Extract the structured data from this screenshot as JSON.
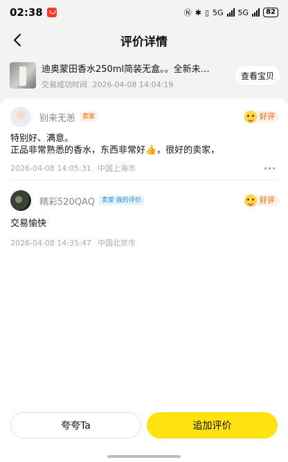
{
  "status_bar": {
    "time": "02:38",
    "net_1": "5G",
    "net_2": "5G",
    "battery": "82",
    "icons": [
      "nfc-icon",
      "bluetooth-icon",
      "vibrate-icon",
      "signal-icon",
      "battery-icon"
    ]
  },
  "nav": {
    "title": "评价详情",
    "back_icon": "back-arrow-icon"
  },
  "product": {
    "title": "迪奥蒙田香水250ml简装无盒。。全新未…",
    "meta_label": "交易成功时间",
    "meta_time": "2026-04-08 14:04:19",
    "view_button": "查看宝贝"
  },
  "reviews": [
    {
      "username": "别来无恙",
      "tag": "卖家",
      "rating": "好评",
      "text": "特别好、满意。\n正品非常熟悉的香水，东西非常好👍，很好的卖家，",
      "time": "2026-04-08 14:05:31",
      "location": "中国上海市"
    },
    {
      "username": "精彩520QAQ",
      "tag": "卖家·我的评价",
      "rating": "好评",
      "text": "交易愉快",
      "time": "2026-04-08 14:35:47",
      "location": "中国北京市"
    }
  ],
  "bottom": {
    "praise_button": "夸夸Ta",
    "add_button": "追加评价"
  },
  "colors": {
    "accent": "#ffe20f",
    "seller_tag": "#ff6a00",
    "buyer_tag": "#1f8fe5",
    "rating": "#ff5a00"
  }
}
